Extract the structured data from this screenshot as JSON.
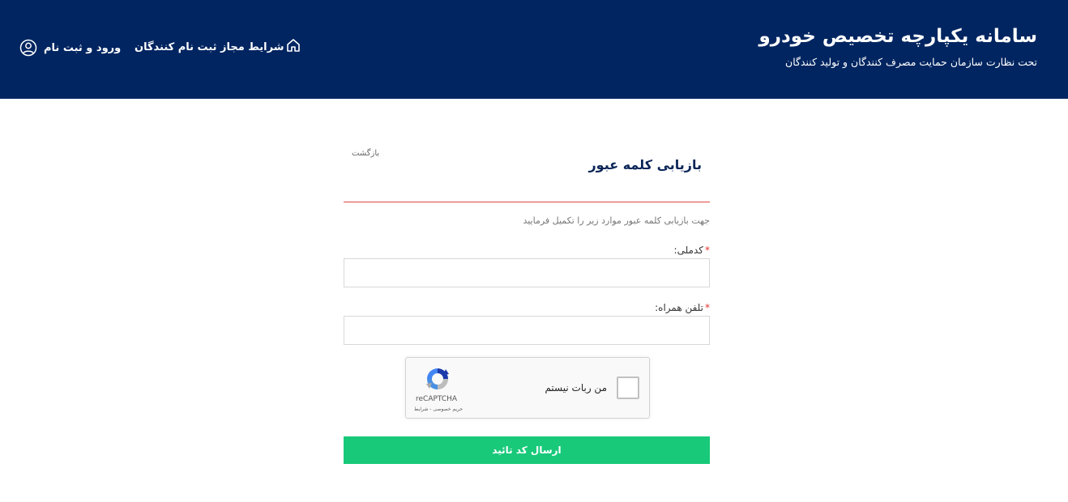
{
  "header": {
    "title": "سامانه یکپارچه تخصیص خودرو",
    "subtitle": "تحت نظارت سازمان حمایت مصرف کنندگان و تولید کنندگان",
    "background_color": "#002561"
  },
  "nav": {
    "login_label": "ورود و ثبت نام",
    "terms_label": "شرایط مجاز ثبت نام کنندگان",
    "home_icon": "home-icon",
    "user_icon": "user-circle-icon"
  },
  "form": {
    "title": "بازیابی کلمه عبور",
    "back_label": "بازگشت",
    "instructions": "جهت بازیابی کلمه عبور موارد زیر را تکمیل فرمایید",
    "required_mark": "*",
    "fields": [
      {
        "label": "کدملی:",
        "value": "",
        "placeholder": ""
      },
      {
        "label": "تلفن همراه:",
        "value": "",
        "placeholder": ""
      }
    ],
    "accent_color": "#e0463d"
  },
  "recaptcha": {
    "checkbox_label": "من ربات نیستم",
    "brand": "reCAPTCHA",
    "links": "حریم خصوصی - شرایط"
  },
  "submit": {
    "label": "ارسال کد تائید",
    "color": "#18c97a"
  }
}
